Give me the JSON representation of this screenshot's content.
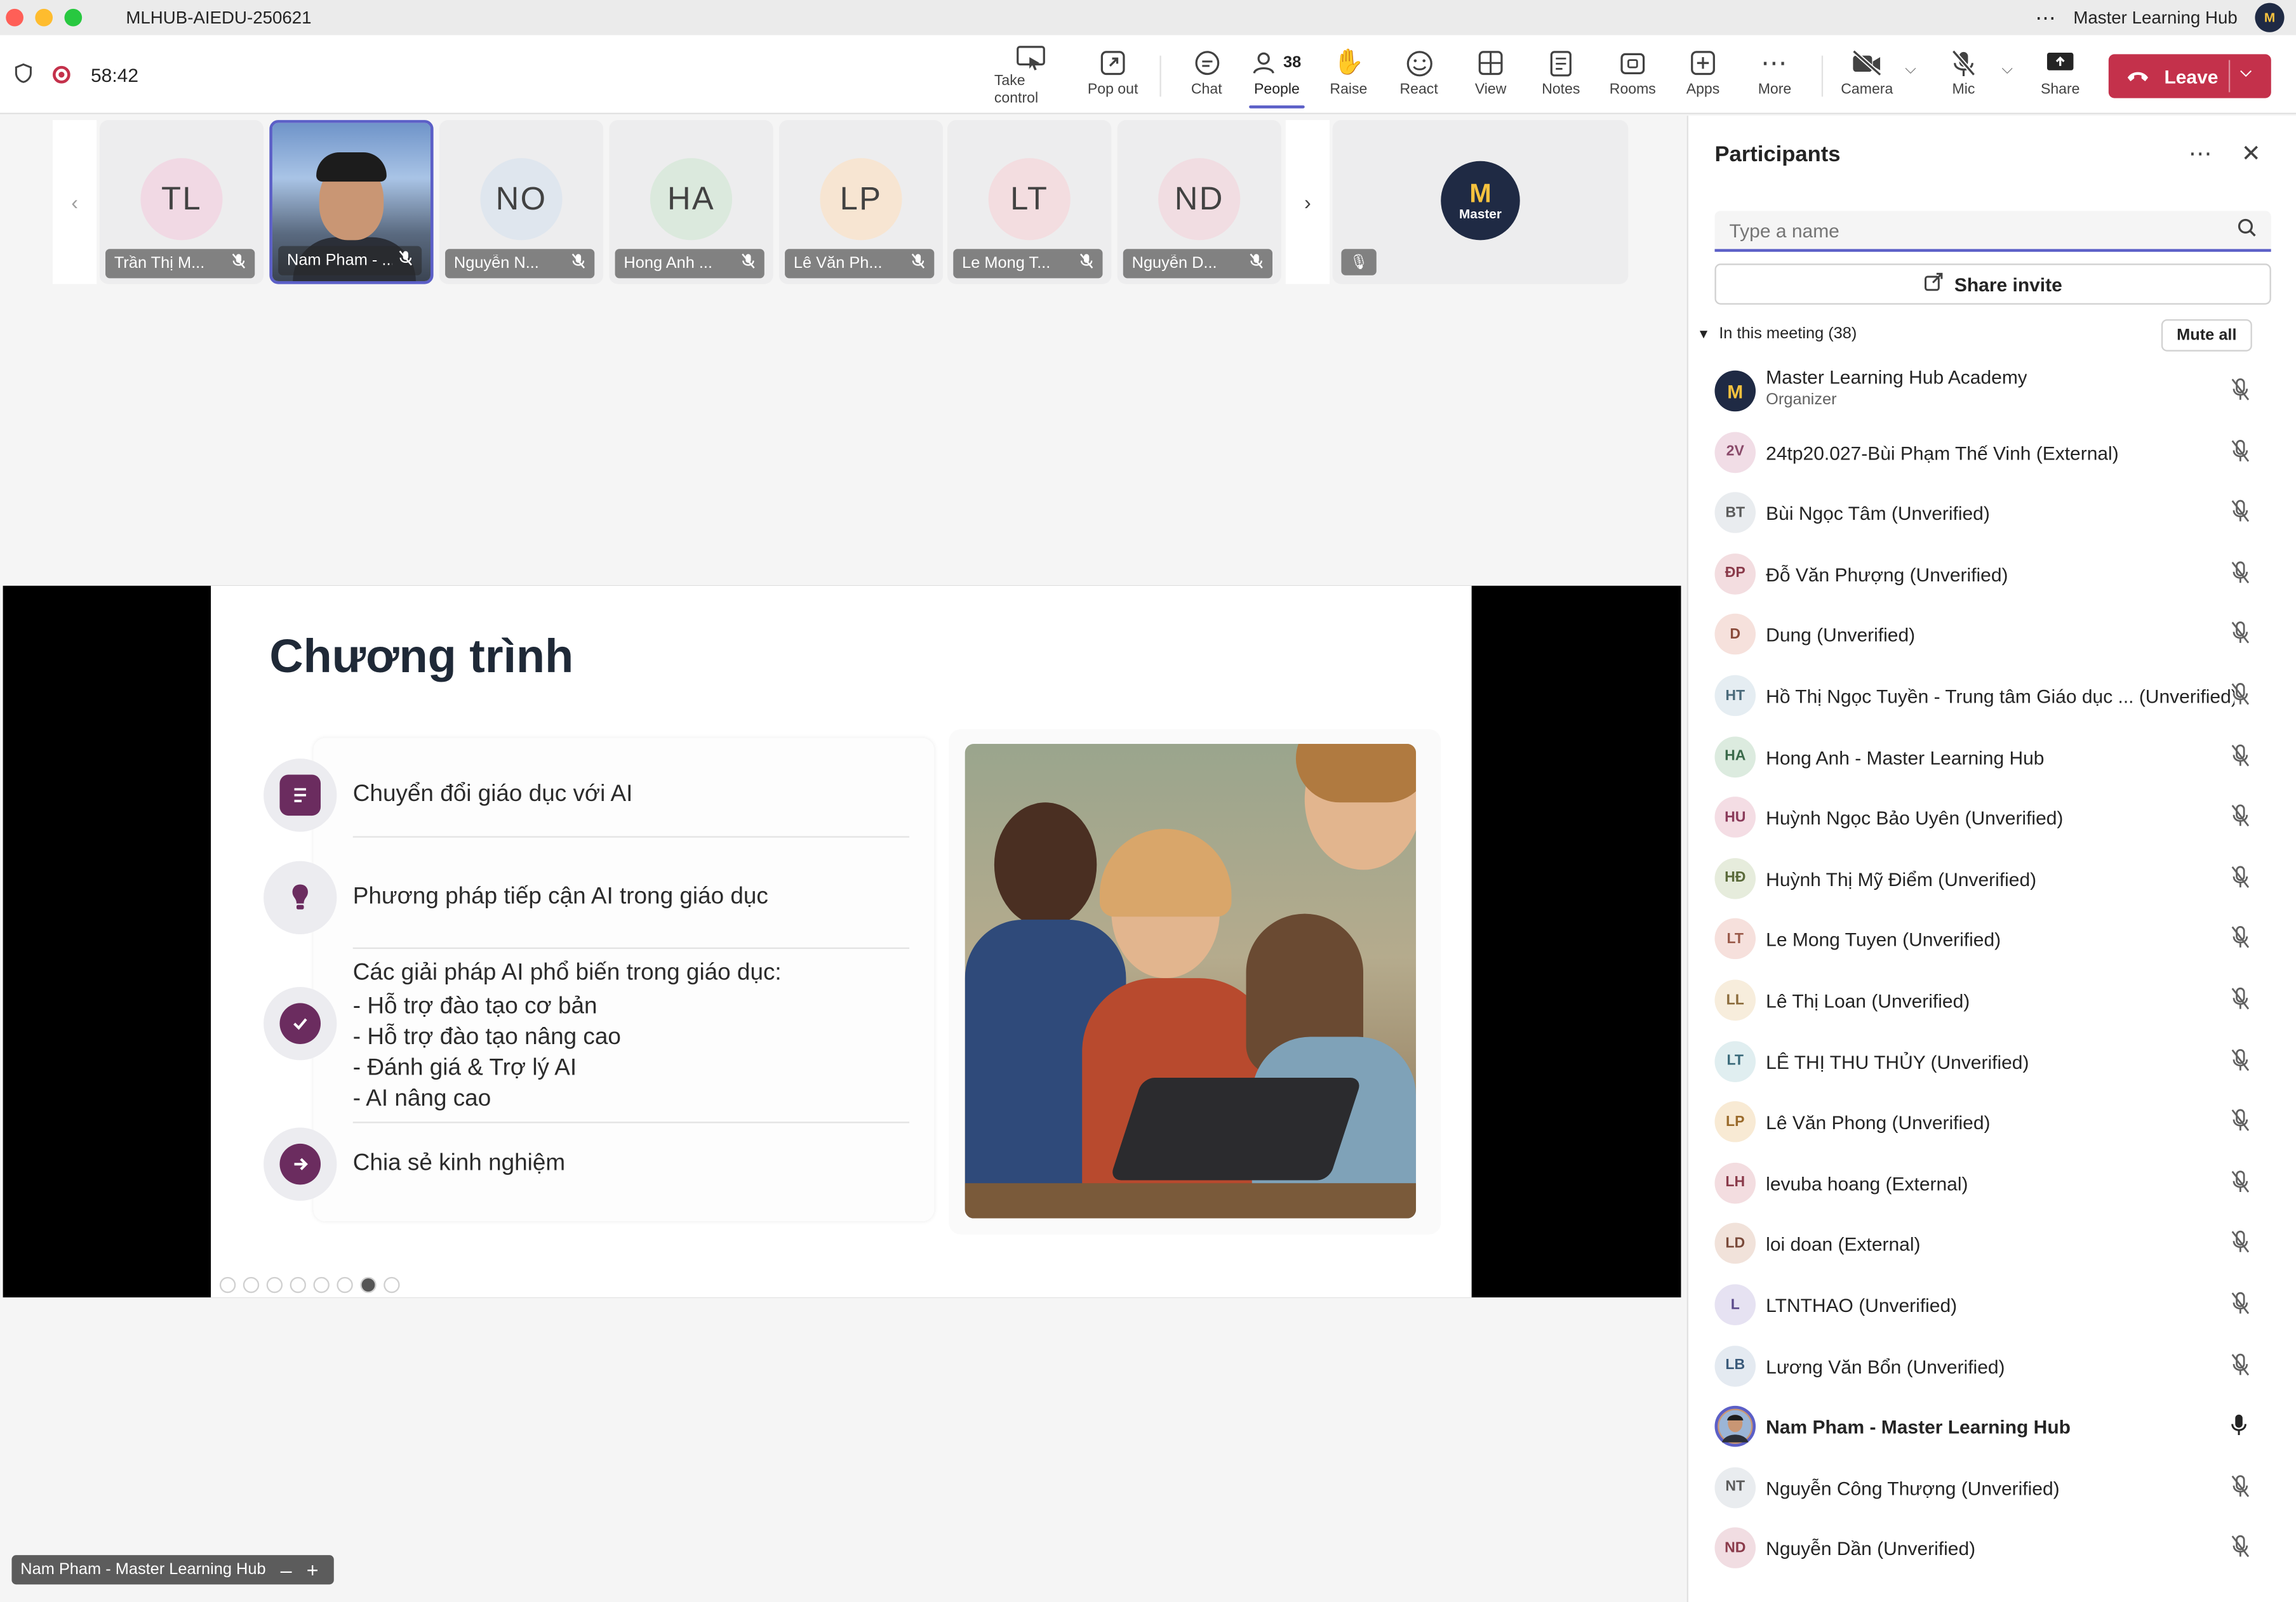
{
  "window": {
    "title": "MLHUB-AIEDU-250621",
    "account_name": "Master Learning Hub",
    "more_icon": "ellipsis-icon"
  },
  "toolbar": {
    "timer": "58:42",
    "people_count": "38",
    "buttons": {
      "take_control": "Take control",
      "pop_out": "Pop out",
      "chat": "Chat",
      "people": "People",
      "raise": "Raise",
      "react": "React",
      "view": "View",
      "notes": "Notes",
      "rooms": "Rooms",
      "apps": "Apps",
      "more": "More",
      "camera": "Camera",
      "mic": "Mic",
      "share": "Share",
      "leave": "Leave"
    },
    "colors": {
      "leave": "#c4314b",
      "accent": "#5b5fc7"
    }
  },
  "gallery": [
    {
      "initials": "TL",
      "name": "Trần Thị M...",
      "color": "#f1d9e4"
    },
    {
      "initials": "",
      "name": "Nam Pham - ...",
      "color": "#6f94c9"
    },
    {
      "initials": "NO",
      "name": "Nguyễn N...",
      "color": "#dfe6ee"
    },
    {
      "initials": "HA",
      "name": "Hong Anh ...",
      "color": "#dbe9dd"
    },
    {
      "initials": "LP",
      "name": "Lê Văn Ph...",
      "color": "#f7e5d2"
    },
    {
      "initials": "LT",
      "name": "Le Mong T...",
      "color": "#f3dde0"
    },
    {
      "initials": "ND",
      "name": "Nguyễn D...",
      "color": "#f1dde2"
    }
  ],
  "organizer_tile": {
    "logo_letter": "M",
    "logo_text": "Master"
  },
  "slide": {
    "title": "Chương trình",
    "items": [
      "Chuyển đổi giáo dục với AI",
      "Phương pháp tiếp cận AI trong giáo dục",
      "Các giải pháp AI phổ biến trong giáo dục:",
      "Chia sẻ kinh nghiệm"
    ],
    "sub_items": [
      "-   Hỗ trợ đào tạo cơ bản",
      "-   Hỗ trợ đào tạo nâng cao",
      "-   Đánh giá & Trợ lý AI",
      "-   AI nâng cao"
    ]
  },
  "presenter_label": "Nam Pham - Master Learning Hub",
  "participants_panel": {
    "title": "Participants",
    "search_placeholder": "Type a name",
    "share_invite": "Share invite",
    "section": "In this meeting (38)",
    "mute_all": "Mute all",
    "people": [
      {
        "initials": "M",
        "name": "Master Learning Hub Academy",
        "role": "Organizer",
        "bg": "#1f2a44",
        "fg": "#f6c23e",
        "mic": "off"
      },
      {
        "initials": "2V",
        "name": "24tp20.027-Bùi Phạm Thế Vinh (External)",
        "bg": "#f1dde6",
        "fg": "#8a4a6a",
        "mic": "off"
      },
      {
        "initials": "BT",
        "name": "Bùi Ngọc Tâm (Unverified)",
        "bg": "#e9ecef",
        "fg": "#5a5a5a",
        "mic": "off"
      },
      {
        "initials": "ĐP",
        "name": "Đỗ Văn Phượng (Unverified)",
        "bg": "#f3dde0",
        "fg": "#8a3a4a",
        "mic": "off"
      },
      {
        "initials": "D",
        "name": "Dung (Unverified)",
        "bg": "#f6e1dc",
        "fg": "#8a4a3a",
        "mic": "off"
      },
      {
        "initials": "HT",
        "name": "Hồ Thị Ngọc Tuyền - Trung tâm Giáo dục ... (Unverified)",
        "bg": "#e5edf2",
        "fg": "#4a6a7a",
        "mic": "off"
      },
      {
        "initials": "HA",
        "name": "Hong Anh - Master Learning Hub",
        "bg": "#dcebdf",
        "fg": "#3a6a4a",
        "mic": "off"
      },
      {
        "initials": "HU",
        "name": "Huỳnh Ngọc Bảo Uyên (Unverified)",
        "bg": "#f4dde4",
        "fg": "#8a3a5a",
        "mic": "off"
      },
      {
        "initials": "HĐ",
        "name": "Huỳnh Thị Mỹ Điểm (Unverified)",
        "bg": "#e6ecdc",
        "fg": "#5a6a3a",
        "mic": "off"
      },
      {
        "initials": "LT",
        "name": "Le Mong Tuyen (Unverified)",
        "bg": "#f6e0dc",
        "fg": "#9a5a4a",
        "mic": "off"
      },
      {
        "initials": "LL",
        "name": "Lê Thị Loan (Unverified)",
        "bg": "#f7eddc",
        "fg": "#8a6a3a",
        "mic": "off"
      },
      {
        "initials": "LT",
        "name": "LÊ THỊ THU THỦY (Unverified)",
        "bg": "#e0eef0",
        "fg": "#3a6a7a",
        "mic": "off"
      },
      {
        "initials": "LP",
        "name": "Lê Văn Phong (Unverified)",
        "bg": "#f8ead4",
        "fg": "#9a6a2a",
        "mic": "off"
      },
      {
        "initials": "LH",
        "name": "levuba hoang (External)",
        "bg": "#f3dde0",
        "fg": "#8a3a4a",
        "mic": "off"
      },
      {
        "initials": "LD",
        "name": "loi doan (External)",
        "bg": "#f1e2da",
        "fg": "#7a4a3a",
        "mic": "off"
      },
      {
        "initials": "L",
        "name": "LTNTHAO (Unverified)",
        "bg": "#e6e2f2",
        "fg": "#5a4a8a",
        "mic": "off"
      },
      {
        "initials": "LB",
        "name": "Lương Văn Bổn (Unverified)",
        "bg": "#e4eaf1",
        "fg": "#3a5a7a",
        "mic": "off"
      },
      {
        "initials": "",
        "name": "Nam Pham - Master Learning Hub",
        "bg": "#c99674",
        "fg": "#ffffff",
        "mic": "on",
        "me": true
      },
      {
        "initials": "NT",
        "name": "Nguyễn Công Thượng (Unverified)",
        "bg": "#e9ecef",
        "fg": "#5a5a5a",
        "mic": "off"
      },
      {
        "initials": "ND",
        "name": "Nguyễn Dần (Unverified)",
        "bg": "#f1dde2",
        "fg": "#8a3a4a",
        "mic": "off"
      }
    ]
  }
}
